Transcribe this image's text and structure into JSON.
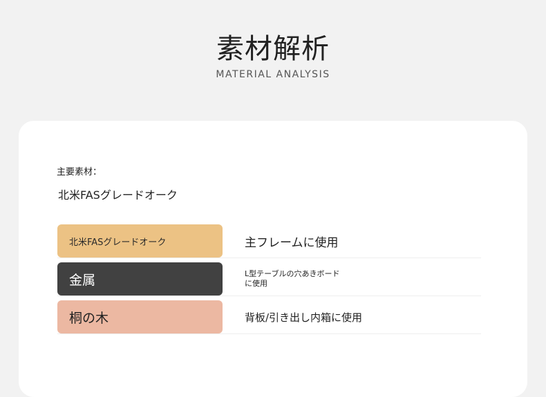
{
  "header": {
    "title": "素材解析",
    "subtitle": "MATERIAL ANALYSIS"
  },
  "main_material": {
    "label": "主要素材：",
    "value": "北米FASグレードオーク"
  },
  "materials": [
    {
      "name": "北米FASグレードオーク",
      "usage": "主フレームに使用",
      "color": "#ecc284"
    },
    {
      "name": "金属",
      "usage_line1": "L型テーブルの穴あきボード",
      "usage_line2": "に使用",
      "color": "#414141"
    },
    {
      "name": "桐の木",
      "usage": "背板/引き出し内箱に使用",
      "color": "#ecb8a2"
    }
  ]
}
